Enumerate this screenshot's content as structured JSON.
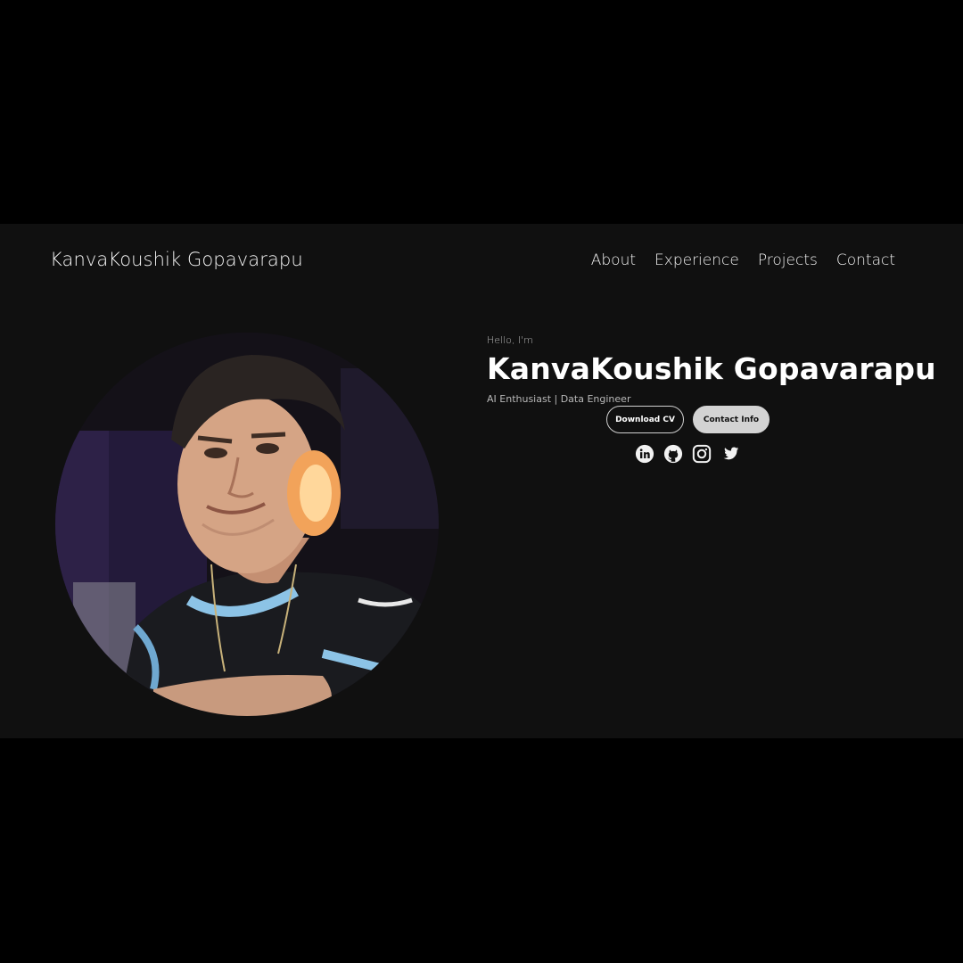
{
  "header": {
    "brand": "KanvaKoushik Gopavarapu",
    "nav": [
      {
        "label": "About"
      },
      {
        "label": "Experience"
      },
      {
        "label": "Projects"
      },
      {
        "label": "Contact"
      }
    ]
  },
  "hero": {
    "greeting": "Hello, I'm",
    "name": "KanvaKoushik Gopavarapu",
    "subtitle": "AI Enthusiast | Data Engineer",
    "buttons": {
      "download_cv": "Download CV",
      "contact_info": "Contact Info"
    },
    "socials": [
      {
        "icon": "linkedin-icon"
      },
      {
        "icon": "github-icon"
      },
      {
        "icon": "instagram-icon"
      },
      {
        "icon": "twitter-icon"
      }
    ]
  },
  "colors": {
    "page_background": "#101010",
    "letterbox": "#000000",
    "text": "#ffffff",
    "muted_text": "#b8b8b8",
    "solid_button": "#d3d3d3"
  }
}
